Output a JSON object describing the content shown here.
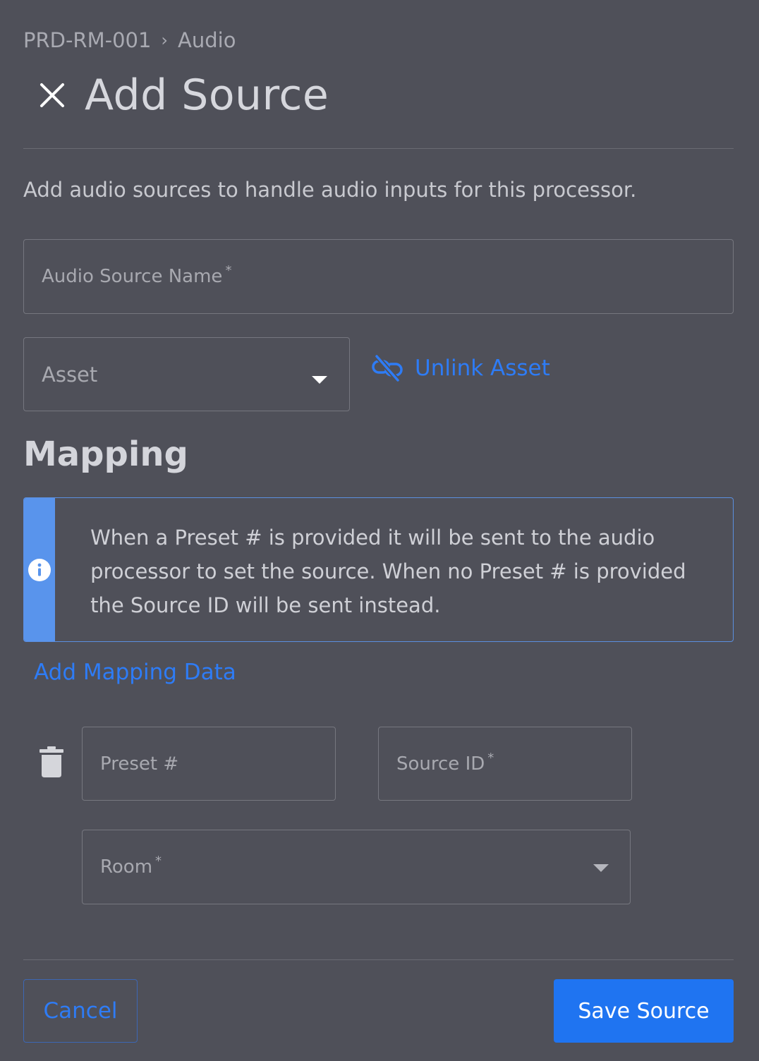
{
  "breadcrumb": {
    "parent": "PRD-RM-001",
    "separator": "›",
    "current": "Audio"
  },
  "header": {
    "title": "Add Source",
    "close_icon": "close-icon"
  },
  "description": "Add audio sources to handle audio inputs for this processor.",
  "form": {
    "source_name": {
      "label": "Audio Source Name",
      "required_mark": "*",
      "value": ""
    },
    "asset": {
      "label": "Asset",
      "value": ""
    },
    "unlink_asset_label": "Unlink Asset"
  },
  "mapping": {
    "title": "Mapping",
    "info_text": "When a Preset # is provided it will be sent to the audio processor to set the source. When no Preset # is provided the Source ID will be sent instead.",
    "add_label": "Add Mapping Data",
    "row": {
      "preset": {
        "label": "Preset #",
        "value": ""
      },
      "source_id": {
        "label": "Source ID",
        "required_mark": "*",
        "value": ""
      },
      "room": {
        "label": "Room",
        "required_mark": "*",
        "value": ""
      }
    }
  },
  "footer": {
    "cancel_label": "Cancel",
    "save_label": "Save Source"
  },
  "colors": {
    "background": "#4f5059",
    "accent": "#1f74f1",
    "link": "#2e7cf6",
    "info_stripe": "#5994ec"
  }
}
